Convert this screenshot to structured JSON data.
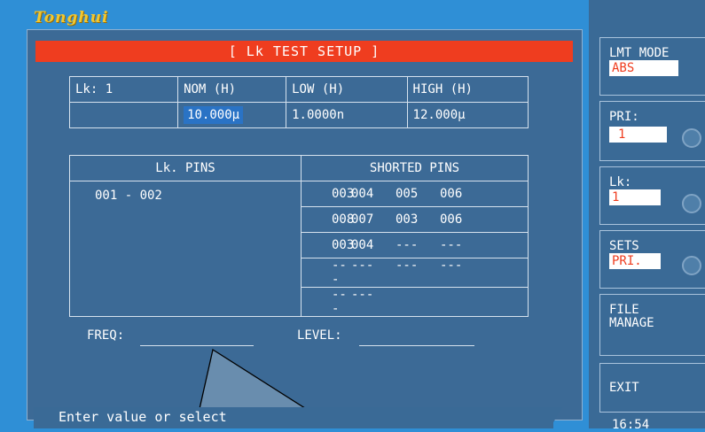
{
  "brand": "Tonghui",
  "title": "[ Lk TEST SETUP ]",
  "limits_table": {
    "headers": [
      "Lk:  1",
      "NOM  (H)",
      "LOW  (H)",
      "HIGH (H)"
    ],
    "values": [
      "",
      "10.000µ",
      "1.0000n",
      "12.000µ"
    ]
  },
  "pins_table": {
    "headers": [
      "Lk. PINS",
      "SHORTED PINS"
    ],
    "lk_pins": "001 - 002",
    "shorted_rows": [
      [
        "003",
        "004",
        "005",
        "006"
      ],
      [
        "008",
        "007",
        "003",
        "006"
      ],
      [
        "003",
        "004",
        "---",
        "---"
      ],
      [
        "---",
        "---",
        "---",
        "---"
      ],
      [
        "---",
        "---",
        "",
        ""
      ]
    ]
  },
  "freq_label": "FREQ:",
  "freq_value": "",
  "level_label": "LEVEL:",
  "level_value": "",
  "status": "Enter value or select",
  "softkeys": {
    "lmt_mode": {
      "label": "LMT MODE",
      "value": "ABS"
    },
    "pri": {
      "label": "PRI:",
      "value": "1"
    },
    "lk": {
      "label": "Lk:",
      "value": "1"
    },
    "sets": {
      "label": "SETS",
      "value": "PRI."
    },
    "file_manage": {
      "label1": "FILE",
      "label2": "MANAGE"
    },
    "exit": {
      "label": "EXIT"
    }
  },
  "clock": "16:54",
  "colors": {
    "title_bar": "#ef3d1f",
    "panel": "#3c6a96",
    "background": "#2f8fd6",
    "brand": "#f2c830"
  }
}
